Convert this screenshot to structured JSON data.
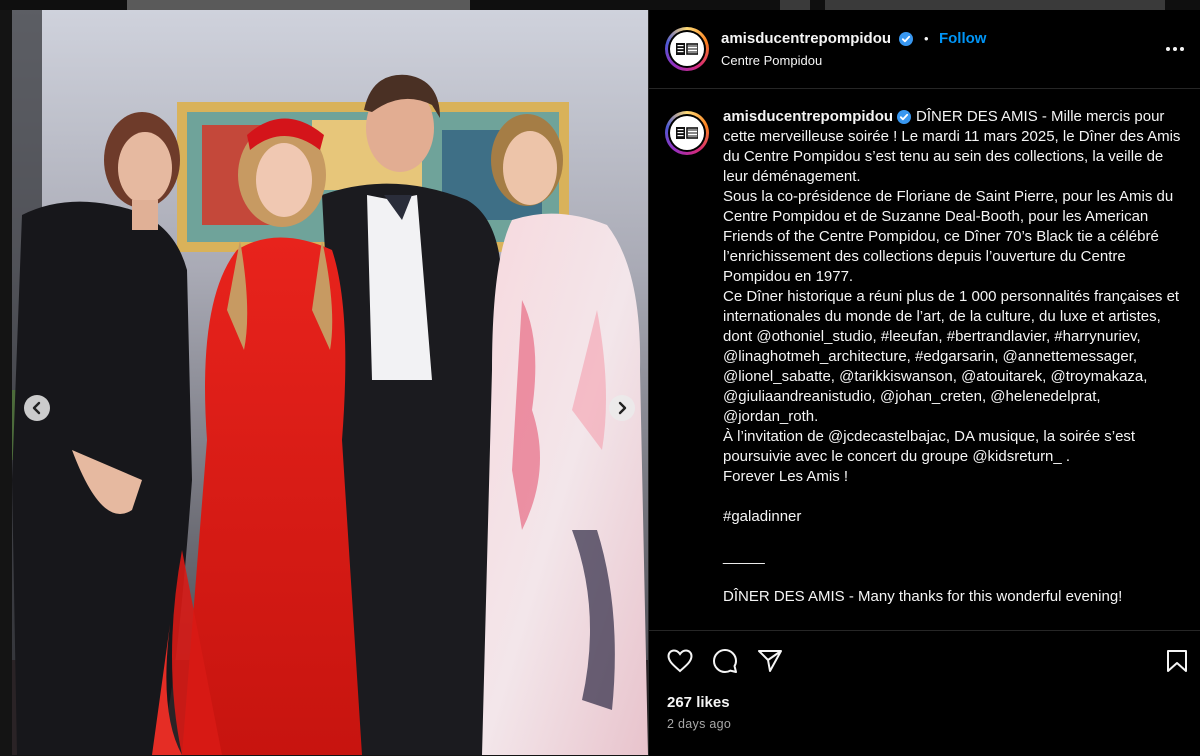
{
  "post": {
    "account": "amisducentrepompidou",
    "location": "Centre Pompidou",
    "follow_label": "Follow",
    "separator": "•",
    "caption_intro": "DÎNER DES AMIS - Mille mercis pour cette merveilleuse soirée ! Le mardi 11 mars 2025, le Dîner des Amis du Centre Pompidou s’est tenu au sein des collections, la veille de leur déménagement.\nSous la co-présidence de Floriane de Saint Pierre, pour les Amis du Centre Pompidou et de Suzanne Deal-Booth, pour les American Friends of the Centre Pompidou, ce Dîner 70’s Black tie a célébré l’enrichissement des collections depuis l’ouverture du Centre Pompidou en 1977.\nCe Dîner historique a réuni plus de 1 000 personnalités françaises et internationales du monde de l’art, de la culture, du luxe et artistes, dont @othoniel_studio, #leeufan, #bertrandlavier, #harrynuriev, @linaghotmeh_architecture, #edgarsarin, @annettemessager, @lionel_sabatte, @tarikkiswanson, @atouitarek, @troymakaza, @giuliaandreanistudio, @johan_creten, @helenedelprat, @jordan_roth.\nÀ l’invitation de @jcdecastelbajac, DA musique, la soirée s’est poursuivie avec le concert du groupe @kidsreturn_ .\nForever Les Amis !\n\n#galadinner\n\n_____\n\nDÎNER DES AMIS - Many thanks for this wonderful evening!",
    "likes": "267 likes",
    "posted_ago": "2 days ago"
  },
  "icons": {
    "verified": "verified-badge-icon",
    "more": "more-options-icon",
    "like": "heart-icon",
    "comment": "comment-icon",
    "share": "share-icon",
    "save": "bookmark-icon",
    "prev": "chevron-left-icon",
    "next": "chevron-right-icon"
  },
  "colors": {
    "accent": "#0095f6",
    "verified": "#3897f0",
    "panel_bg": "#000000",
    "secondary_text": "#a8a8a8"
  }
}
